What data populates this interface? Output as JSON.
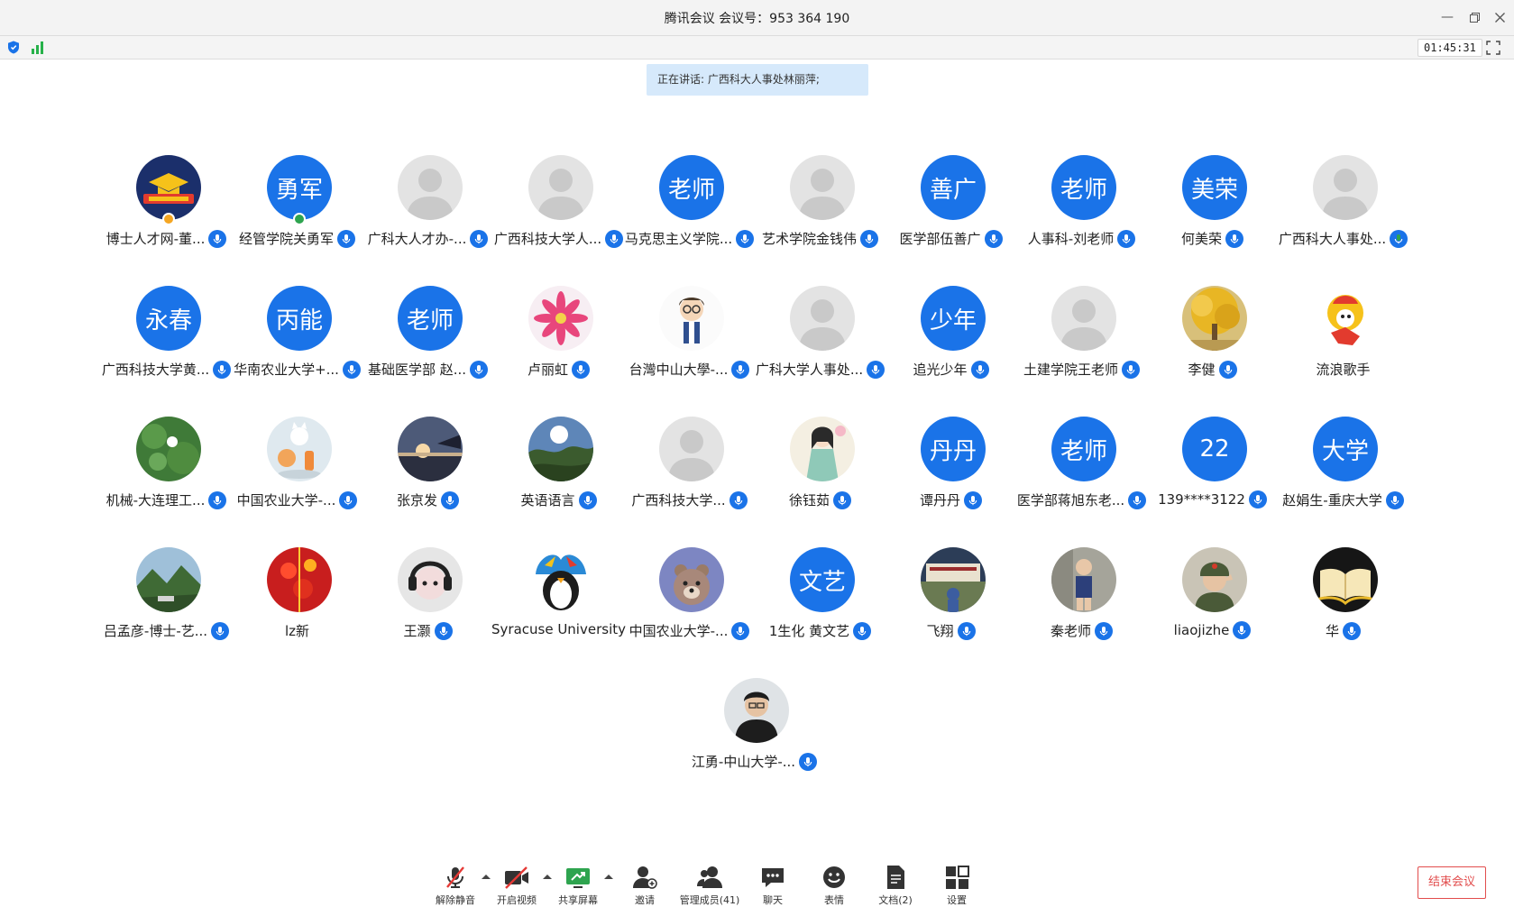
{
  "window": {
    "title": "腾讯会议  会议号：953 364 190",
    "timer": "01:45:31"
  },
  "speaking_banner": "正在讲话: 广西科大人事处林丽萍;",
  "colors": {
    "accent": "#1a73e8",
    "speaking_bg": "#d6e9fb",
    "end_button": "#e24d4d"
  },
  "participants": [
    {
      "name": "博士人才网-董...",
      "avatar": "logo",
      "avatar_text": "",
      "mic": "blue",
      "badge": "host"
    },
    {
      "name": "经管学院关勇军",
      "avatar": "text",
      "avatar_text": "勇军",
      "mic": "blue",
      "badge": "cohost"
    },
    {
      "name": "广科大人才办-...",
      "avatar": "default",
      "avatar_text": "",
      "mic": "blue"
    },
    {
      "name": "广西科技大学人...",
      "avatar": "default",
      "avatar_text": "",
      "mic": "blue"
    },
    {
      "name": "马克思主义学院...",
      "avatar": "text",
      "avatar_text": "老师",
      "mic": "blue"
    },
    {
      "name": "艺术学院金钱伟",
      "avatar": "default",
      "avatar_text": "",
      "mic": "blue"
    },
    {
      "name": "医学部伍善广",
      "avatar": "text",
      "avatar_text": "善广",
      "mic": "blue"
    },
    {
      "name": "人事科-刘老师",
      "avatar": "text",
      "avatar_text": "老师",
      "mic": "blue"
    },
    {
      "name": "何美荣",
      "avatar": "text",
      "avatar_text": "美荣",
      "mic": "blue"
    },
    {
      "name": "广西科大人事处...",
      "avatar": "default",
      "avatar_text": "",
      "mic": "green"
    },
    {
      "name": "广西科技大学黄...",
      "avatar": "text",
      "avatar_text": "永春",
      "mic": "blue"
    },
    {
      "name": "华南农业大学+...",
      "avatar": "text",
      "avatar_text": "丙能",
      "mic": "blue"
    },
    {
      "name": "基础医学部  赵...",
      "avatar": "text",
      "avatar_text": "老师",
      "mic": "blue"
    },
    {
      "name": "卢丽虹",
      "avatar": "flower",
      "avatar_text": "",
      "mic": "blue"
    },
    {
      "name": "台灣中山大學-...",
      "avatar": "cartoon",
      "avatar_text": "",
      "mic": "blue"
    },
    {
      "name": "广科大学人事处...",
      "avatar": "default",
      "avatar_text": "",
      "mic": "blue"
    },
    {
      "name": "追光少年",
      "avatar": "text",
      "avatar_text": "少年",
      "mic": "blue"
    },
    {
      "name": "土建学院王老师",
      "avatar": "default",
      "avatar_text": "",
      "mic": "blue"
    },
    {
      "name": "李健",
      "avatar": "tree",
      "avatar_text": "",
      "mic": "blue"
    },
    {
      "name": "流浪歌手",
      "avatar": "mascot",
      "avatar_text": "",
      "mic": "none"
    },
    {
      "name": "机械-大连理工...",
      "avatar": "lotus",
      "avatar_text": "",
      "mic": "blue"
    },
    {
      "name": "中国农业大学-...",
      "avatar": "cat",
      "avatar_text": "",
      "mic": "blue"
    },
    {
      "name": "张京发",
      "avatar": "sunset",
      "avatar_text": "",
      "mic": "blue"
    },
    {
      "name": "英语语言",
      "avatar": "sky",
      "avatar_text": "",
      "mic": "blue"
    },
    {
      "name": "广西科技大学...",
      "avatar": "default",
      "avatar_text": "",
      "mic": "blue"
    },
    {
      "name": "徐钰茹",
      "avatar": "girl",
      "avatar_text": "",
      "mic": "blue"
    },
    {
      "name": "谭丹丹",
      "avatar": "text",
      "avatar_text": "丹丹",
      "mic": "blue"
    },
    {
      "name": "医学部蒋旭东老...",
      "avatar": "text",
      "avatar_text": "老师",
      "mic": "blue"
    },
    {
      "name": "139****3122",
      "avatar": "text",
      "avatar_text": "22",
      "mic": "blue"
    },
    {
      "name": "赵娟生-重庆大学",
      "avatar": "text",
      "avatar_text": "大学",
      "mic": "blue"
    },
    {
      "name": "吕孟彦-博士-艺...",
      "avatar": "mountain",
      "avatar_text": "",
      "mic": "blue"
    },
    {
      "name": "lz新",
      "avatar": "red",
      "avatar_text": "",
      "mic": "none"
    },
    {
      "name": "王灏",
      "avatar": "headphone",
      "avatar_text": "",
      "mic": "blue"
    },
    {
      "name": "Syracuse University",
      "avatar": "penguin",
      "avatar_text": "",
      "mic": "none"
    },
    {
      "name": "中国农业大学-...",
      "avatar": "bear",
      "avatar_text": "",
      "mic": "blue"
    },
    {
      "name": "1生化 黄文艺",
      "avatar": "text",
      "avatar_text": "文艺",
      "mic": "blue"
    },
    {
      "name": "飞翔",
      "avatar": "building",
      "avatar_text": "",
      "mic": "blue"
    },
    {
      "name": "秦老师",
      "avatar": "kid",
      "avatar_text": "",
      "mic": "blue"
    },
    {
      "name": "liaojizhe",
      "avatar": "soldier",
      "avatar_text": "",
      "mic": "blue"
    },
    {
      "name": "华",
      "avatar": "book",
      "avatar_text": "",
      "mic": "blue"
    },
    {
      "name": "江勇-中山大学-...",
      "avatar": "man",
      "avatar_text": "",
      "mic": "blue"
    }
  ],
  "toolbar": {
    "unmute": "解除静音",
    "video": "开启视频",
    "share": "共享屏幕",
    "invite": "邀请",
    "members": "管理成员(41)",
    "chat": "聊天",
    "reaction": "表情",
    "docs": "文档(2)",
    "settings": "设置",
    "end": "结束会议"
  }
}
